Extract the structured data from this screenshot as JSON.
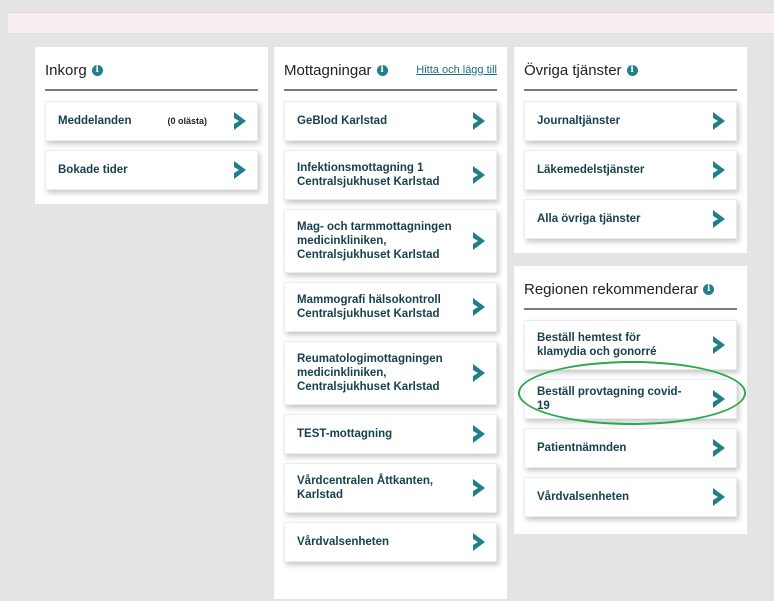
{
  "inbox": {
    "title": "Inkorg",
    "items": [
      {
        "label": "Meddelanden",
        "badge": "(0 olästa)"
      },
      {
        "label": "Bokade tider"
      }
    ]
  },
  "clinics": {
    "title": "Mottagningar",
    "link": "Hitta och lägg till",
    "items": [
      {
        "label": "GeBlod Karlstad"
      },
      {
        "label": "Infektionsmottagning 1 Centralsjukhuset Karlstad"
      },
      {
        "label": "Mag- och tarmmottagningen medicinkliniken, Centralsjukhuset Karlstad"
      },
      {
        "label": "Mammografi hälsokontroll Centralsjukhuset Karlstad"
      },
      {
        "label": "Reumatologimottagningen medicinkliniken, Centralsjukhuset Karlstad"
      },
      {
        "label": "TEST-mottagning"
      },
      {
        "label": "Vårdcentralen Åttkanten, Karlstad"
      },
      {
        "label": "Vårdvalsenheten"
      }
    ]
  },
  "other_services": {
    "title": "Övriga tjänster",
    "items": [
      {
        "label": "Journaltjänster"
      },
      {
        "label": "Läkemedelstjänster"
      },
      {
        "label": "Alla övriga tjänster"
      }
    ]
  },
  "recommended": {
    "title": "Regionen rekommenderar",
    "items": [
      {
        "label": "Beställ hemtest för klamydia och gonorré"
      },
      {
        "label": "Beställ provtagning covid-19"
      },
      {
        "label": "Patientnämnden"
      },
      {
        "label": "Vårdvalsenheten"
      }
    ]
  },
  "colors": {
    "accent": "#1f7f8a",
    "highlight": "#2ca84a"
  },
  "icons": {
    "info": "info-icon",
    "chevron": "chevron-right-icon"
  }
}
